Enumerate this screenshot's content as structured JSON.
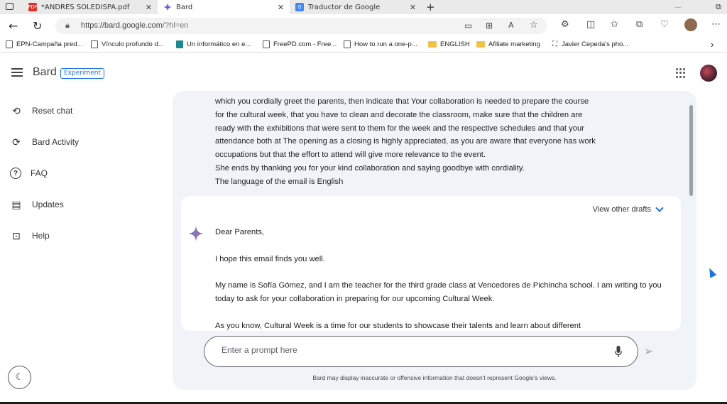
{
  "browser": {
    "tabs": [
      {
        "title": "*ANDRES SOLEDISPA.pdf",
        "icon": "pdf-icon",
        "active": false
      },
      {
        "title": "Bard",
        "icon": "bard-sparkle-icon",
        "active": true
      },
      {
        "title": "Traductor de Google",
        "icon": "google-translate-icon",
        "active": false
      }
    ],
    "new_tab_glyph": "+",
    "url": {
      "host": "https://bard.google.com",
      "path": "/?hl=en"
    },
    "bookmarks": [
      {
        "label": "EPN-Campaña pred...",
        "icon": "page-icon"
      },
      {
        "label": "Vínculo profundo d...",
        "icon": "page-icon"
      },
      {
        "label": "Un informático en e...",
        "icon": "site-icon"
      },
      {
        "label": "FreePD.com - Free...",
        "icon": "page-icon"
      },
      {
        "label": "How to run a one-p...",
        "icon": "page-icon"
      },
      {
        "label": "ENGLISH",
        "icon": "folder-icon"
      },
      {
        "label": "Afiliate marketing",
        "icon": "folder-icon"
      },
      {
        "label": "Javier Cepeda's pho...",
        "icon": "app-icon"
      }
    ]
  },
  "app": {
    "brand": "Bard",
    "badge": "Experiment",
    "sidebar": [
      {
        "label": "Reset chat",
        "icon": "reset-icon"
      },
      {
        "label": "Bard Activity",
        "icon": "history-icon"
      },
      {
        "label": "FAQ",
        "icon": "help-circle-icon"
      },
      {
        "label": "Updates",
        "icon": "updates-icon"
      },
      {
        "label": "Help",
        "icon": "feedback-icon"
      }
    ]
  },
  "chat": {
    "user_message_lines": [
      "which you cordially greet the parents, then indicate that Your collaboration is needed to prepare the course",
      "for the cultural week, that you have to clean and decorate the classroom, make sure that the children are",
      "ready with the exhibitions that were sent to them for the week and the respective schedules and that your",
      "attendance both at The opening as a closing is highly appreciated, as you are aware that everyone has work",
      "occupations but that the effort to attend will give more relevance to the event.",
      "She ends by thanking you for your kind collaboration and saying goodbye with cordiality.",
      "The language of the email is English"
    ],
    "view_drafts_label": "View other drafts",
    "response_paragraphs": [
      "Dear Parents,",
      "I hope this email finds you well.",
      "My name is Sofía Gómez, and I am the teacher for the third grade class at Vencedores de Pichincha school. I am writing to you today to ask for your collaboration in preparing for our upcoming Cultural Week.",
      "As you know, Cultural Week is a time for our students to showcase their talents and learn about different"
    ],
    "prompt_placeholder": "Enter a prompt here",
    "disclaimer": "Bard may display inaccurate or offensive information that doesn't represent Google's views."
  },
  "colors": {
    "accent": "#1a73e8",
    "panel": "#f0f4f9"
  }
}
